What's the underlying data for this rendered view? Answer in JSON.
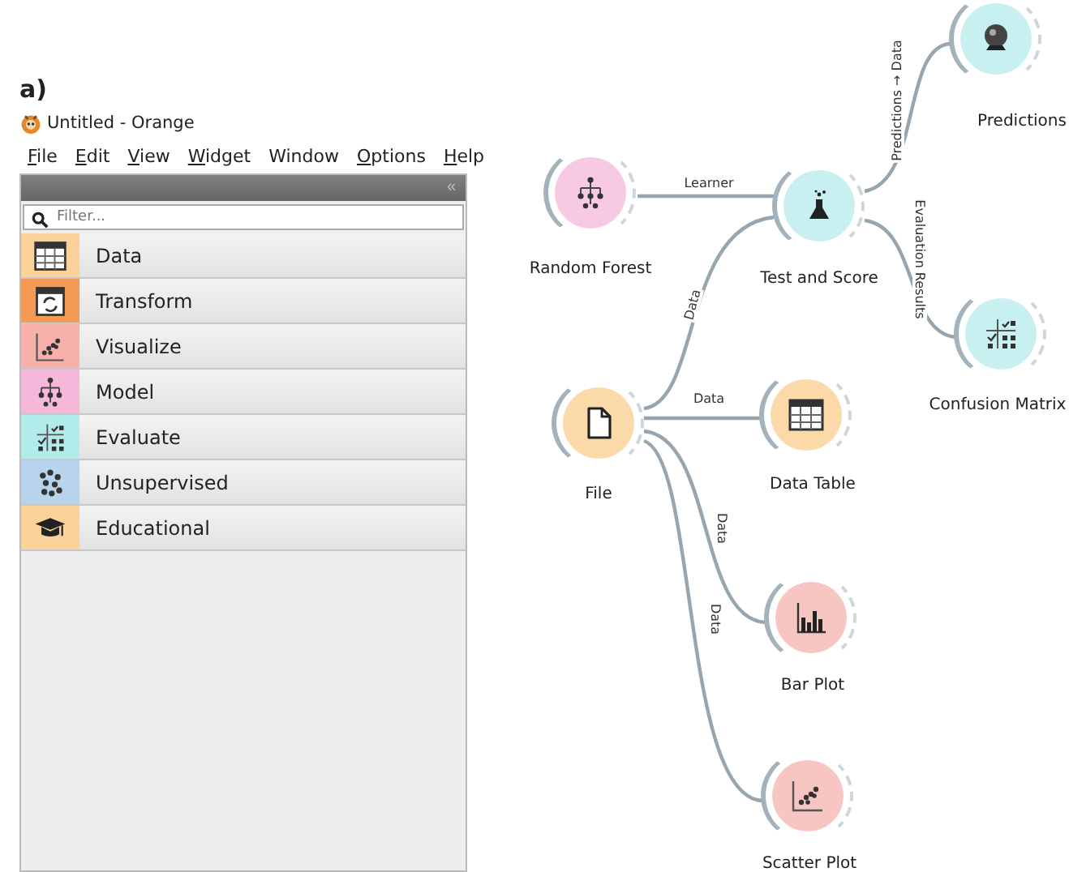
{
  "figure_label": "a)",
  "window": {
    "title": "Untitled  - Orange"
  },
  "menu": [
    {
      "label": "File",
      "underlined": true
    },
    {
      "label": "Edit",
      "underlined": true
    },
    {
      "label": "View",
      "underlined": true
    },
    {
      "label": "Widget",
      "underlined": true
    },
    {
      "label": "Window",
      "underlined": false
    },
    {
      "label": "Options",
      "underlined": true
    },
    {
      "label": "Help",
      "underlined": true
    }
  ],
  "sidebar": {
    "collapse": "«",
    "search": {
      "placeholder": "Filter..."
    },
    "categories": [
      {
        "label": "Data",
        "color": "#fbd39a",
        "kind": "table"
      },
      {
        "label": "Transform",
        "color": "#f59a55",
        "kind": "transform"
      },
      {
        "label": "Visualize",
        "color": "#f7b0aa",
        "kind": "scatter"
      },
      {
        "label": "Model",
        "color": "#f6b8da",
        "kind": "tree"
      },
      {
        "label": "Evaluate",
        "color": "#b2ecea",
        "kind": "evaluate"
      },
      {
        "label": "Unsupervised",
        "color": "#b8d4ec",
        "kind": "clusters"
      },
      {
        "label": "Educational",
        "color": "#fbd39a",
        "kind": "graduation"
      }
    ]
  },
  "canvas": {
    "nodes": [
      {
        "label": "Predictions",
        "color": "#c9f0f0",
        "kind": "ball"
      },
      {
        "label": "Random Forest",
        "color": "#f8c9e2",
        "kind": "tree"
      },
      {
        "label": "Test and Score",
        "color": "#c9f0f0",
        "kind": "flask"
      },
      {
        "label": "Confusion Matrix",
        "color": "#c9f0f0",
        "kind": "evaluate"
      },
      {
        "label": "File",
        "color": "#fcd9a9",
        "kind": "document"
      },
      {
        "label": "Data Table",
        "color": "#fcd9a9",
        "kind": "table"
      },
      {
        "label": "Bar Plot",
        "color": "#f8c6c2",
        "kind": "bars"
      },
      {
        "label": "Scatter Plot",
        "color": "#f8c6c2",
        "kind": "scatter"
      }
    ],
    "links": [
      {
        "label": "Learner"
      },
      {
        "label": "Data"
      },
      {
        "label": "Predictions → Data"
      },
      {
        "label": "Evaluation Results"
      },
      {
        "label": "Data"
      },
      {
        "label": "Data"
      },
      {
        "label": "Data"
      }
    ]
  }
}
